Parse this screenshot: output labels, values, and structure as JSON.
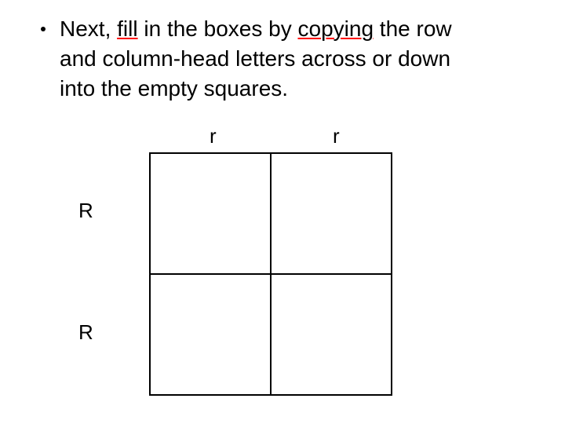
{
  "bullet": {
    "pre1": "Next, ",
    "fill": "fill",
    "mid1": " in the boxes by ",
    "copying": "copying",
    "post1": " the row",
    "line2": "and column-head letters across or down",
    "line3": "into the empty squares."
  },
  "punnett": {
    "col1": "r",
    "col2": "r",
    "row1": "R",
    "row2": "R"
  }
}
